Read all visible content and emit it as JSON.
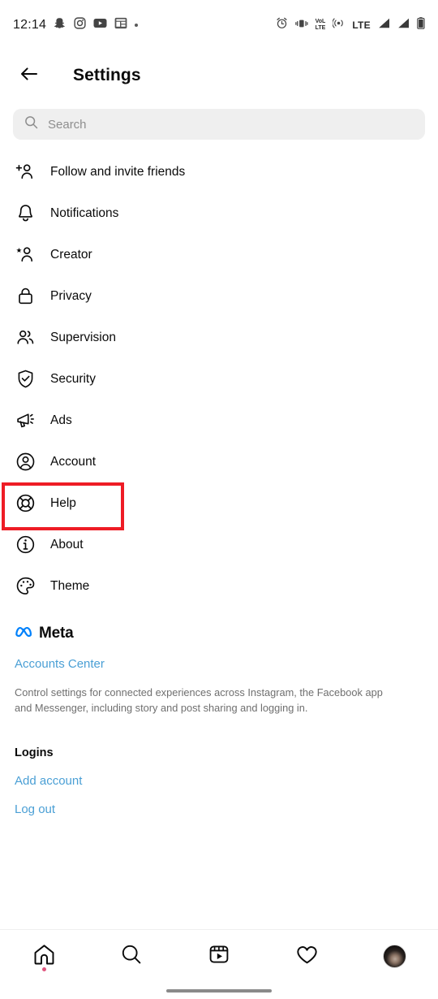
{
  "statusbar": {
    "clock": "12:14",
    "left_icons": [
      "snapchat-icon",
      "instagram-icon",
      "youtube-icon",
      "app-icon",
      "overflow-dot-icon"
    ],
    "right_icons": [
      "alarm-icon",
      "vibrate-icon",
      "volte-icon",
      "hotspot-icon",
      "lte-icon",
      "signal-bars-icon",
      "signal-bars-2-icon",
      "battery-icon"
    ],
    "lte_label": "LTE",
    "volte_label_top": "VoLTE",
    "volte_label_top1": "VoL",
    "volte_label_bottom": "LTE"
  },
  "header": {
    "title": "Settings",
    "back_icon": "arrow-left-icon"
  },
  "search": {
    "placeholder": "Search",
    "value": "",
    "icon": "search-icon"
  },
  "settings_items": [
    {
      "label": "Follow and invite friends",
      "icon": "person-add-icon",
      "highlighted": false
    },
    {
      "label": "Notifications",
      "icon": "bell-icon",
      "highlighted": false
    },
    {
      "label": "Creator",
      "icon": "person-star-icon",
      "highlighted": false
    },
    {
      "label": "Privacy",
      "icon": "lock-icon",
      "highlighted": false
    },
    {
      "label": "Supervision",
      "icon": "people-icon",
      "highlighted": false
    },
    {
      "label": "Security",
      "icon": "shield-check-icon",
      "highlighted": false
    },
    {
      "label": "Ads",
      "icon": "megaphone-icon",
      "highlighted": false
    },
    {
      "label": "Account",
      "icon": "account-circle-icon",
      "highlighted": false
    },
    {
      "label": "Help",
      "icon": "lifebuoy-icon",
      "highlighted": true
    },
    {
      "label": "About",
      "icon": "info-circle-icon",
      "highlighted": false
    },
    {
      "label": "Theme",
      "icon": "palette-icon",
      "highlighted": false
    }
  ],
  "meta": {
    "logo_icon": "meta-infinity-icon",
    "wordmark": "Meta",
    "accounts_center_link": "Accounts Center",
    "description": "Control settings for connected experiences across Instagram, the Facebook app and Messenger, including story and post sharing and logging in.",
    "logins_heading": "Logins",
    "add_account_link": "Add account",
    "logout_link": "Log out"
  },
  "bottom_nav": [
    {
      "name": "home",
      "icon": "home-icon",
      "badge": true
    },
    {
      "name": "search",
      "icon": "search-icon",
      "badge": false
    },
    {
      "name": "reels",
      "icon": "reels-icon",
      "badge": false
    },
    {
      "name": "activity",
      "icon": "heart-icon",
      "badge": false
    },
    {
      "name": "profile",
      "icon": "avatar-icon",
      "badge": false
    }
  ],
  "colors": {
    "highlight_red": "#ee1c25",
    "link_blue": "#4a9fd5",
    "meta_blue": "#0081fb",
    "badge_pink": "#e0567f",
    "search_bg": "#efefef",
    "text_primary": "#0a0a0a",
    "text_muted": "#6f6f6f"
  }
}
